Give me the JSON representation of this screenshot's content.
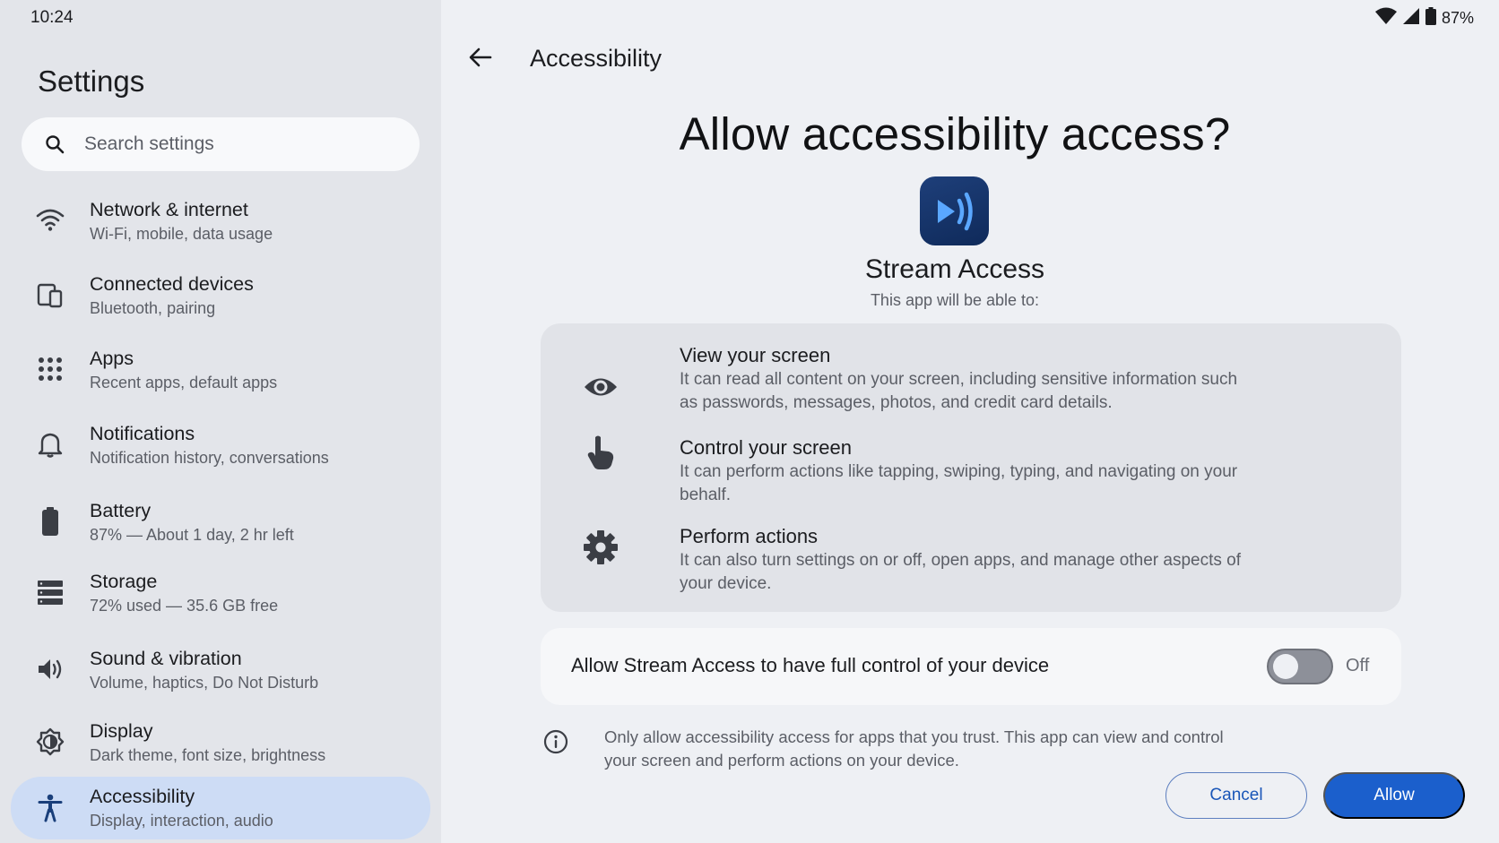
{
  "status_bar": {
    "time": "10:24",
    "battery_percent": "87%"
  },
  "sidebar": {
    "title": "Settings",
    "search": {
      "placeholder": "Search settings"
    },
    "items": [
      {
        "icon": "wifi-icon",
        "title": "Network & internet",
        "subtitle": "Wi-Fi, mobile, data usage"
      },
      {
        "icon": "devices-icon",
        "title": "Connected devices",
        "subtitle": "Bluetooth, pairing"
      },
      {
        "icon": "apps-grid-icon",
        "title": "Apps",
        "subtitle": "Recent apps, default apps"
      },
      {
        "icon": "bell-icon",
        "title": "Notifications",
        "subtitle": "Notification history, conversations"
      },
      {
        "icon": "battery-icon",
        "title": "Battery",
        "subtitle": "87% — About 1 day, 2 hr left"
      },
      {
        "icon": "storage-icon",
        "title": "Storage",
        "subtitle": "72% used — 35.6 GB free"
      },
      {
        "icon": "volume-icon",
        "title": "Sound & vibration",
        "subtitle": "Volume, haptics, Do Not Disturb"
      },
      {
        "icon": "brightness-icon",
        "title": "Display",
        "subtitle": "Dark theme, font size, brightness"
      },
      {
        "icon": "accessibility-icon",
        "title": "Accessibility",
        "subtitle": "Display, interaction, audio",
        "active": true
      }
    ]
  },
  "header": {
    "title": "Accessibility"
  },
  "dialog": {
    "title": "Allow accessibility access?",
    "app_name": "Stream Access",
    "app_subtitle": "This app will be able to:",
    "permissions": [
      {
        "icon": "eye-icon",
        "title": "View your screen",
        "description": "It can read all content on your screen, including sensitive information such as passwords, messages, photos, and credit card details."
      },
      {
        "icon": "touch-icon",
        "title": "Control your screen",
        "description": "It can perform actions like tapping, swiping, typing, and navigating on your behalf."
      },
      {
        "icon": "gear-icon",
        "title": "Perform actions",
        "description": "It can also turn settings on or off, open apps, and manage other aspects of your device."
      }
    ],
    "toggle": {
      "label": "Allow Stream Access to have full control of your device",
      "state_label": "Off",
      "on": false
    },
    "info_text": "Only allow accessibility access for apps that you trust. This app can view and control your screen and perform actions on your device.",
    "buttons": {
      "cancel": "Cancel",
      "allow": "Allow"
    }
  },
  "colors": {
    "accent": "#1b5fcc",
    "sidebar_active": "#cddcf5",
    "app_icon": "#1e3f7a"
  }
}
